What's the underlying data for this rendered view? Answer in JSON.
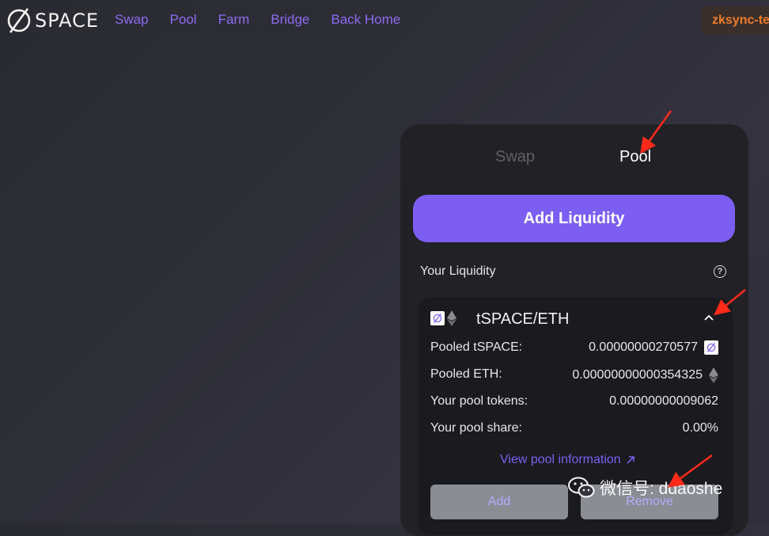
{
  "header": {
    "logo_text": "SPACE",
    "nav": [
      "Swap",
      "Pool",
      "Farm",
      "Bridge",
      "Back Home"
    ],
    "network": "zksync-testnet"
  },
  "panel": {
    "tabs": {
      "swap": "Swap",
      "pool": "Pool"
    },
    "add_liquidity": "Add Liquidity",
    "your_liquidity": "Your Liquidity",
    "help_icon": "?",
    "position": {
      "pair": "tSPACE/ETH",
      "rows": [
        {
          "label": "Pooled tSPACE:",
          "value": "0.00000000270577"
        },
        {
          "label": "Pooled ETH:",
          "value": "0.00000000000354325"
        },
        {
          "label": "Your pool tokens:",
          "value": "0.00000000009062"
        },
        {
          "label": "Your pool share:",
          "value": "0.00%"
        }
      ],
      "view_link": "View pool information",
      "add_button": "Add",
      "remove_button": "Remove"
    }
  },
  "watermark": {
    "text": "微信号: ddaoshe"
  },
  "colors": {
    "accent": "#7c5ef2",
    "network": "#f07c2b",
    "annotation": "#ff2a1a"
  }
}
